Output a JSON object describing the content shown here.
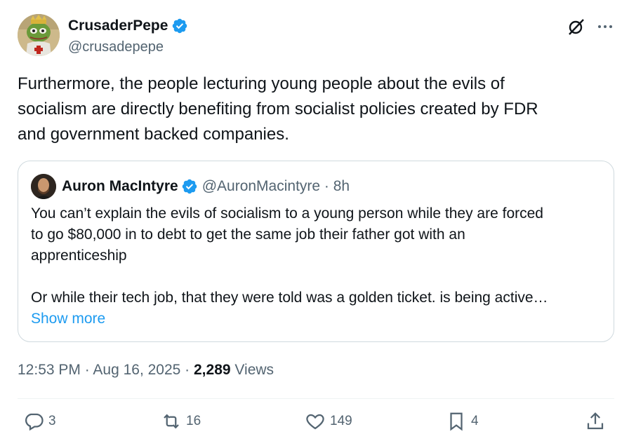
{
  "author": {
    "display_name": "CrusaderPepe",
    "handle": "@crusadepepe"
  },
  "tweet": {
    "lines": [
      "Furthermore, the people lecturing young people about the evils of",
      "socialism are directly benefiting from socialist policies created by FDR",
      "and government backed companies."
    ]
  },
  "quote": {
    "display_name": "Auron MacIntyre",
    "meta": "@AuronMacintyre · 8h",
    "lines": [
      "You can’t explain the evils of socialism to a young person while they are forced",
      "to go $80,000 in to debt to get the same job their father got with an",
      "apprenticeship"
    ],
    "line4": "Or while their tech job, that they were told was a golden ticket. is being active…",
    "show_more": "Show more"
  },
  "meta": {
    "time": "12:53 PM · Aug 16, 2025 · ",
    "views_count": "2,289",
    "views_label": " Views"
  },
  "actions": {
    "replies": "3",
    "reposts": "16",
    "likes": "149",
    "bookmarks": "4"
  },
  "icons": {
    "verified": "verified-badge-icon",
    "grok": "grok-icon",
    "more": "more-icon",
    "reply": "reply-icon",
    "repost": "repost-icon",
    "like": "heart-icon",
    "bookmark": "bookmark-icon",
    "share": "share-icon"
  },
  "colors": {
    "accent": "#1d9bf0",
    "secondary_text": "#536471",
    "primary_text": "#0f1419",
    "border": "#cfd9de"
  }
}
